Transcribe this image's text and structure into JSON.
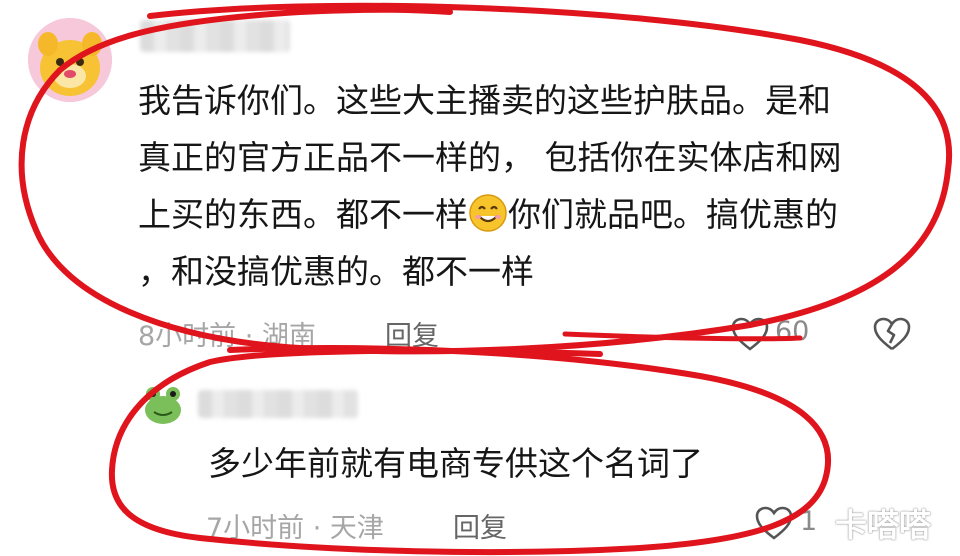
{
  "comments": [
    {
      "text_lines": [
        "我告诉你们。这些大主播卖的这些护肤品。是和",
        "真正的官方正品不一样的， 包括你在实体店和网",
        "上买的东西。都不一样",
        "你们就品吧。搞优惠的",
        "，和没搞优惠的。都不一样"
      ],
      "meta": "8小时前 · 湖南",
      "reply_label": "回复",
      "like_count": "60"
    },
    {
      "text": "多少年前就有电商专供这个名词了",
      "meta": "7小时前 · 天津",
      "reply_label": "回复",
      "like_count": "1"
    }
  ],
  "watermark": "卡嗒嗒",
  "colors": {
    "annotation_red": "#e0141c",
    "meta_gray": "#a6a6a6"
  }
}
